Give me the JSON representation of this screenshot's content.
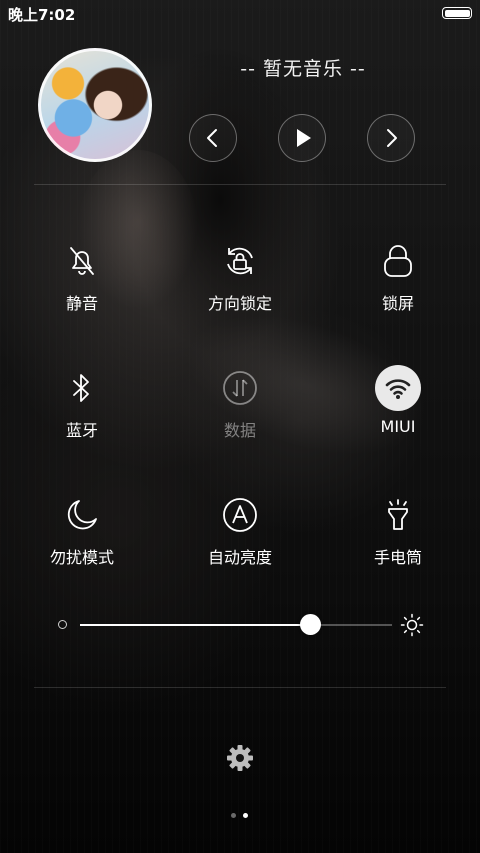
{
  "status_bar": {
    "time": "晚上7:02",
    "battery_level": 1.0
  },
  "music": {
    "title": "-- 暂无音乐 --",
    "controls": [
      "prev",
      "play",
      "next"
    ]
  },
  "toggles": [
    {
      "id": "mute",
      "label": "静音",
      "icon": "bell-off-icon",
      "state": "off"
    },
    {
      "id": "rotation-lock",
      "label": "方向锁定",
      "icon": "rotation-lock-icon",
      "state": "off"
    },
    {
      "id": "lock-screen",
      "label": "锁屏",
      "icon": "lock-icon",
      "state": "off"
    },
    {
      "id": "bluetooth",
      "label": "蓝牙",
      "icon": "bluetooth-icon",
      "state": "off"
    },
    {
      "id": "data",
      "label": "数据",
      "icon": "mobile-data-icon",
      "state": "disabled"
    },
    {
      "id": "wifi",
      "label": "MIUI",
      "icon": "wifi-icon",
      "state": "on"
    },
    {
      "id": "do-not-disturb",
      "label": "勿扰模式",
      "icon": "moon-icon",
      "state": "off"
    },
    {
      "id": "auto-brightness",
      "label": "自动亮度",
      "icon": "auto-brightness-icon",
      "state": "off"
    },
    {
      "id": "flashlight",
      "label": "手电筒",
      "icon": "flashlight-icon",
      "state": "off"
    }
  ],
  "brightness": {
    "level": 0.74
  },
  "pager": {
    "pages": 2,
    "current": 2
  },
  "colors": {
    "active_toggle_bg": "#e9e9e9",
    "text": "#ffffff"
  }
}
